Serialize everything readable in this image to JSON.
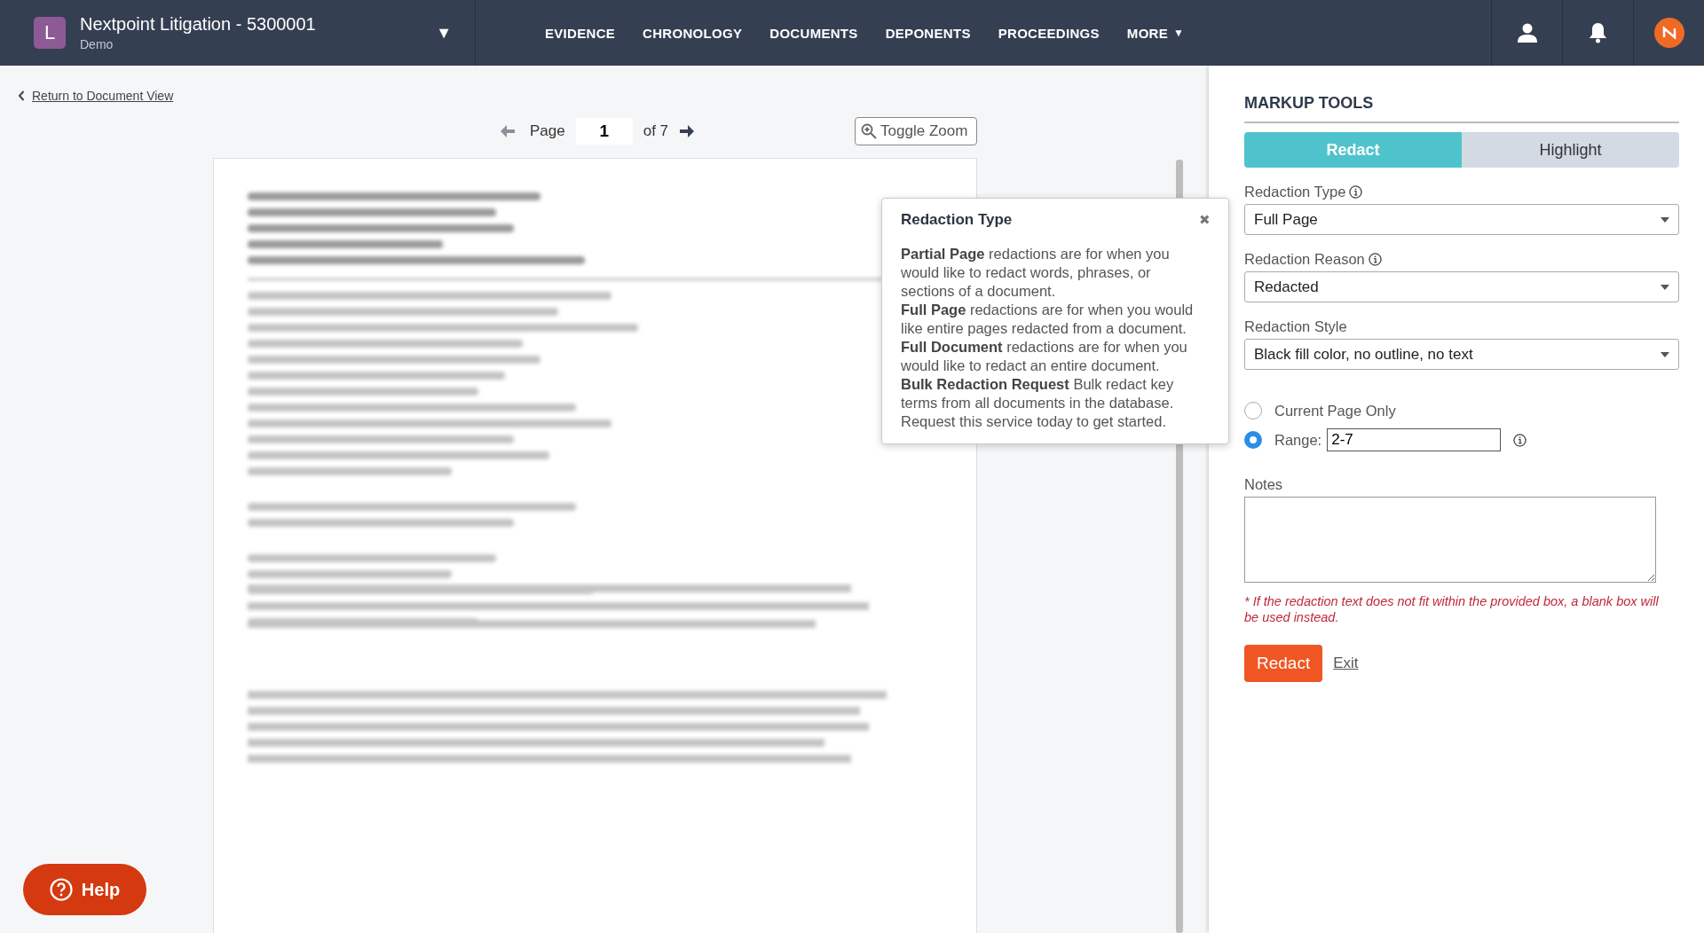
{
  "header": {
    "avatar_letter": "L",
    "project_title": "Nextpoint Litigation - 5300001",
    "project_subtitle": "Demo",
    "project_menu_caret": "▼",
    "nav": [
      {
        "label": "EVIDENCE",
        "dropdown": false
      },
      {
        "label": "CHRONOLOGY",
        "dropdown": false
      },
      {
        "label": "DOCUMENTS",
        "dropdown": false
      },
      {
        "label": "DEPONENTS",
        "dropdown": false
      },
      {
        "label": "PROCEEDINGS",
        "dropdown": false
      },
      {
        "label": "MORE",
        "dropdown": true,
        "caret": "▼"
      }
    ]
  },
  "back_link": "Return to Document View",
  "pager": {
    "label": "Page",
    "value": "1",
    "of": "of 7"
  },
  "toggle_zoom": "Toggle Zoom",
  "popover": {
    "title": "Redaction Type",
    "close": "✖",
    "paragraphs": [
      "**Partial Page** redactions are for when you would like to redact words, phrases, or sections of a document.",
      "**Full Page** redactions are for when you would like entire pages redacted from a document.",
      "**Full Document** redactions are for when you would like to redact an entire document.",
      "**Bulk Redaction Request** Bulk redact key terms from all documents in the database. Request this service today to get started."
    ]
  },
  "panel": {
    "title": "MARKUP TOOLS",
    "tabs": [
      {
        "label": "Redact",
        "selected": true
      },
      {
        "label": "Highlight",
        "selected": false
      }
    ],
    "selects": [
      {
        "label": "Redaction Type",
        "info": true,
        "value": "Full Page"
      },
      {
        "label": "Redaction Reason",
        "info": true,
        "value": "Redacted"
      },
      {
        "label": "Redaction Style",
        "info": false,
        "value": "Black fill color, no outline, no text"
      }
    ],
    "scope": [
      {
        "label": "Current Page Only",
        "selected": false
      },
      {
        "label": "Range:",
        "selected": true,
        "value": "2-7"
      }
    ],
    "notes_label": "Notes",
    "warning": "* If the redaction text does not fit within the provided box, a blank box will be used instead.",
    "submit": "Redact",
    "exit": "Exit"
  },
  "help": "Help"
}
